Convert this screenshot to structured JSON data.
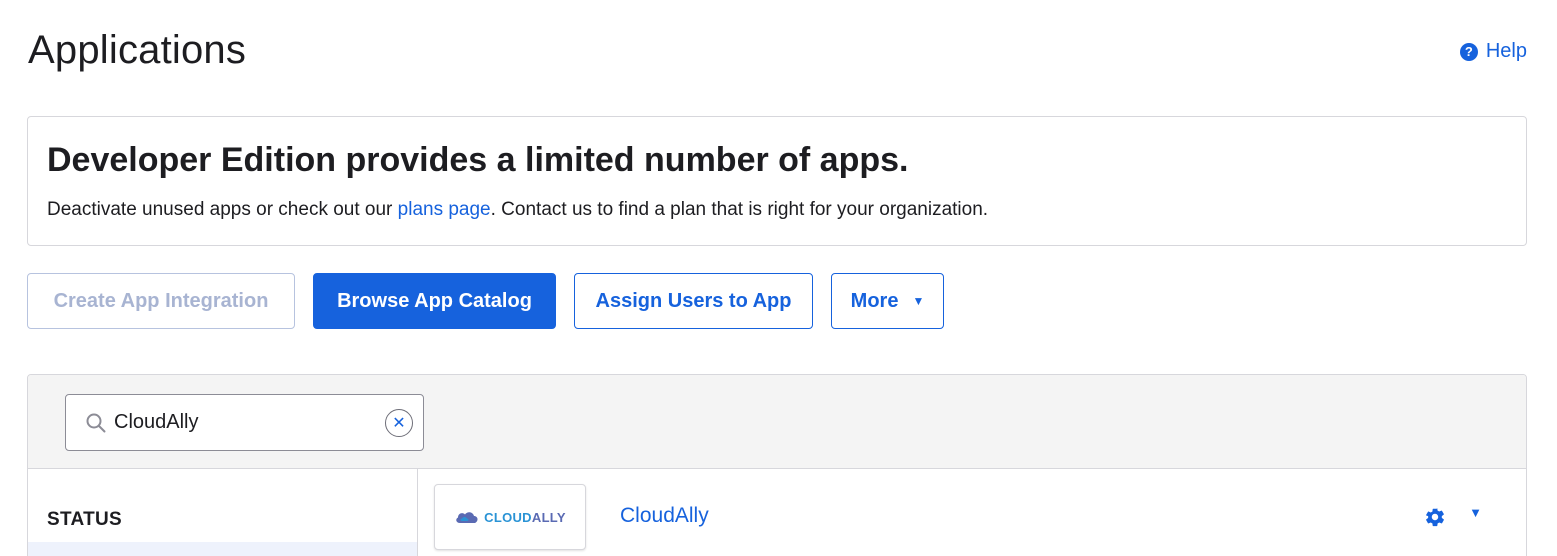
{
  "header": {
    "title": "Applications",
    "help_label": "Help"
  },
  "banner": {
    "title": "Developer Edition provides a limited number of apps.",
    "text_before_link": "Deactivate unused apps or check out our ",
    "link_text": "plans page",
    "text_after_link": ". Contact us to find a plan that is right for your organization."
  },
  "toolbar": {
    "create_label": "Create App Integration",
    "browse_label": "Browse App Catalog",
    "assign_label": "Assign Users to App",
    "more_label": "More"
  },
  "search": {
    "value": "CloudAlly"
  },
  "filters": {
    "status_label": "STATUS"
  },
  "apps": [
    {
      "name": "CloudAlly",
      "logo_text_a": "CLOUD",
      "logo_text_b": "ALLY"
    }
  ],
  "colors": {
    "accent": "#1662dd",
    "disabled_text": "#a8b4d2",
    "panel_header_bg": "#f4f4f4"
  },
  "icons": [
    "help-icon",
    "search-icon",
    "clear-icon",
    "cloud-icon",
    "gear-icon",
    "chevron-down-icon"
  ]
}
